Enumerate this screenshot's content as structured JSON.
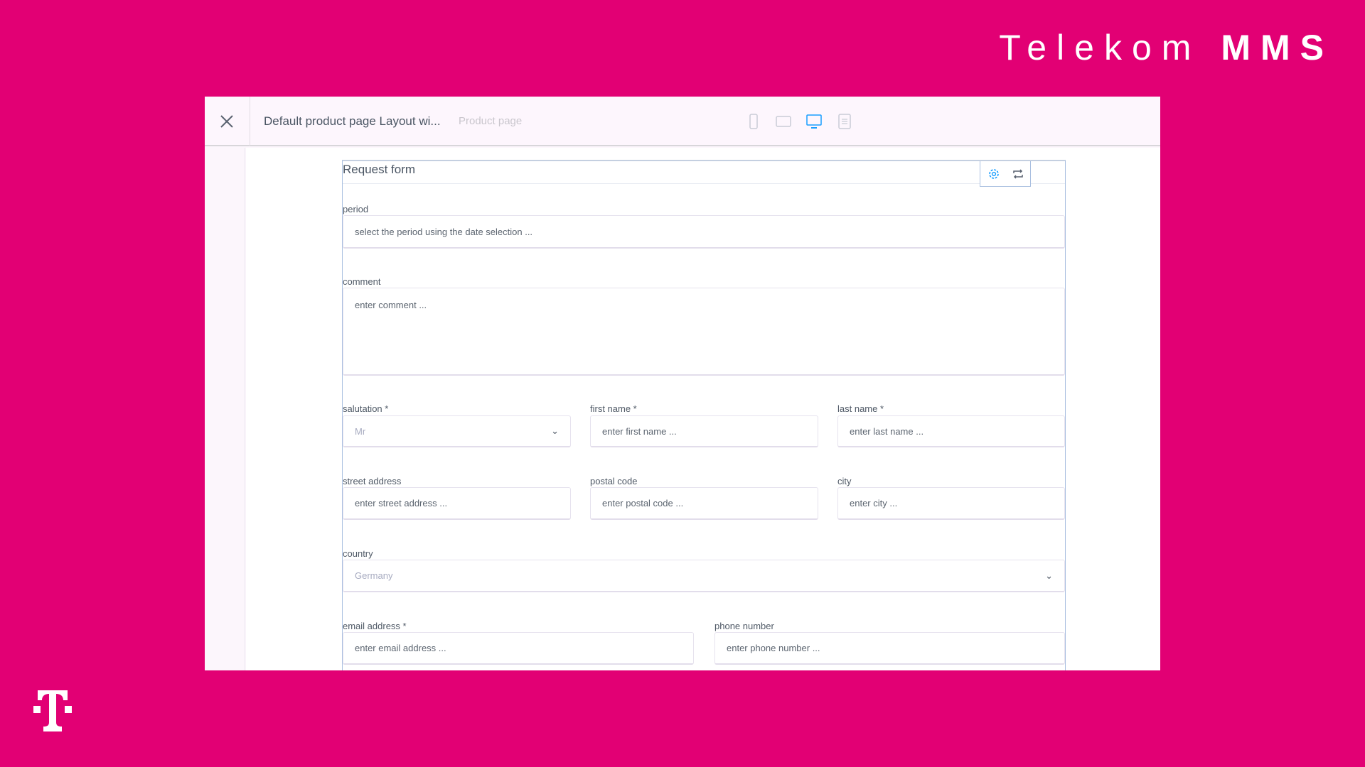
{
  "brand": {
    "light": "Telekom",
    "bold": "MMS",
    "logo_text": "T"
  },
  "header": {
    "title": "Default product page Layout wi...",
    "subtitle": "Product page",
    "devices": [
      "mobile-icon",
      "tablet-icon",
      "desktop-icon",
      "list-icon"
    ],
    "active_device": "desktop-icon"
  },
  "colors": {
    "brand": "#e20074",
    "accent": "#189eff"
  },
  "form": {
    "title": "Request form",
    "period": {
      "label": "period",
      "placeholder": "select the period using the date selection ..."
    },
    "comment": {
      "label": "comment",
      "placeholder": "enter comment ..."
    },
    "salutation": {
      "label": "salutation *",
      "value": "Mr"
    },
    "first_name": {
      "label": "first name *",
      "placeholder": "enter first name ..."
    },
    "last_name": {
      "label": "last name *",
      "placeholder": "enter last name ..."
    },
    "street": {
      "label": "street address",
      "placeholder": "enter street address ..."
    },
    "postal": {
      "label": "postal code",
      "placeholder": "enter postal code ..."
    },
    "city": {
      "label": "city",
      "placeholder": "enter city ..."
    },
    "country": {
      "label": "country",
      "value": "Germany"
    },
    "email": {
      "label": "email address *",
      "placeholder": "enter email address ..."
    },
    "phone": {
      "label": "phone number",
      "placeholder": "enter phone number ..."
    }
  }
}
